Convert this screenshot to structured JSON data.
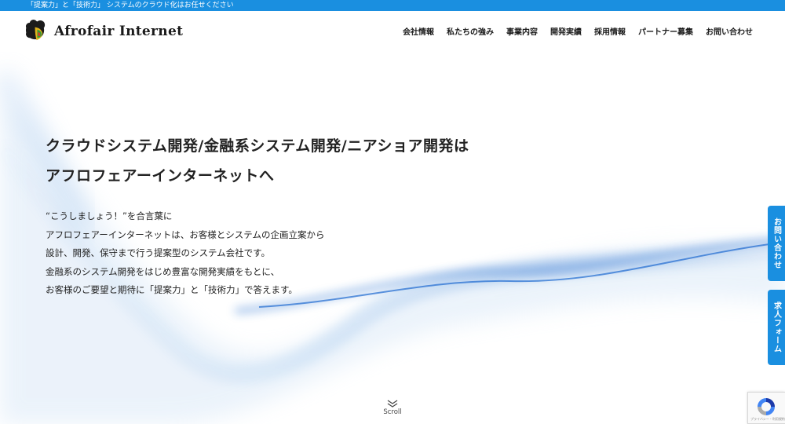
{
  "topbar": {
    "text": "「提案力」と「技術力」 システムのクラウド化はお任せください"
  },
  "header": {
    "logo_text": "Afrofair Internet",
    "nav": [
      "会社情報",
      "私たちの強み",
      "事業内容",
      "開発実績",
      "採用情報",
      "パートナー募集",
      "お問い合わせ"
    ]
  },
  "hero": {
    "title_lines": [
      "クラウドシステム開発/金融系システム開発/ニアショア開発は",
      "アフロフェアーインターネットへ"
    ],
    "desc_lines": [
      "“こうしましょう！”を合言葉に",
      "アフロフェアーインターネットは、お客様とシステムの企画立案から",
      "設計、開発、保守まで行う提案型のシステム会社です。",
      "金融系のシステム開発をはじめ豊富な開発実績をもとに、",
      "お客様のご要望と期待に「提案力」と「技術力」で答えます。"
    ]
  },
  "side_tabs": {
    "contact": "お問い合わせ",
    "recruit": "求人フォーム"
  },
  "scroll": {
    "label": "Scroll"
  },
  "recaptcha": {
    "text": "プライバシー・利用規約"
  },
  "colors": {
    "accent": "#1a8fe0",
    "text": "#222222"
  },
  "icons": {
    "logo": "afro-head-logo-icon",
    "scroll": "double-chevron-down-icon",
    "recaptcha": "recaptcha-icon"
  }
}
